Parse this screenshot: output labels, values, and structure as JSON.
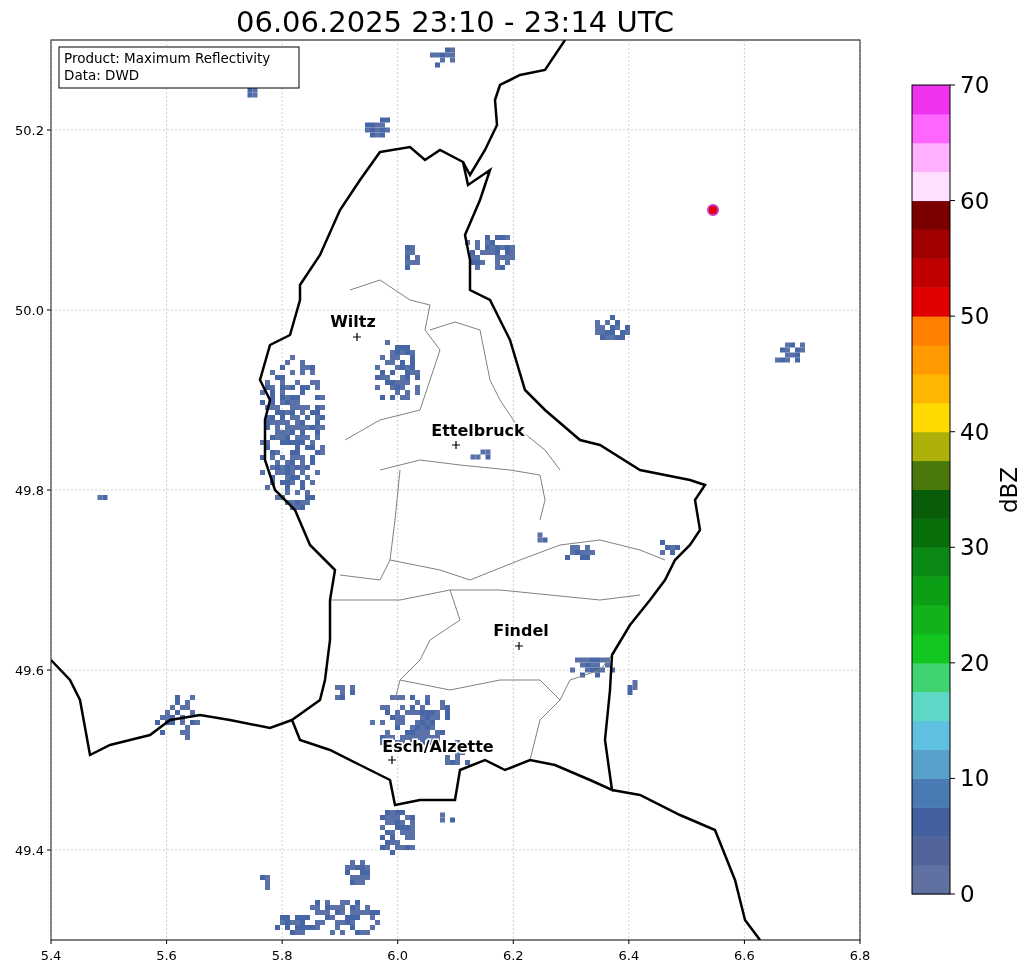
{
  "title": "06.06.2025 23:10 - 23:14 UTC",
  "info_box": {
    "lines": [
      "Product: Maximum Reflectivity",
      "Data: DWD"
    ]
  },
  "map": {
    "x_ticks": [
      "5.4",
      "5.6",
      "5.8",
      "6.0",
      "6.2",
      "6.4",
      "6.6",
      "6.8"
    ],
    "y_ticks": [
      "50.2",
      "50.0",
      "49.8",
      "49.6",
      "49.4"
    ],
    "cities": [
      {
        "name": "Wiltz"
      },
      {
        "name": "Ettelbruck"
      },
      {
        "name": "Findel"
      },
      {
        "name": "Esch/Alzette"
      }
    ]
  },
  "colorbar": {
    "label": "dBZ",
    "ticks": [
      "70",
      "60",
      "50",
      "40",
      "30",
      "20",
      "10",
      "0"
    ],
    "segments": [
      {
        "color": "#6070a0"
      },
      {
        "color": "#52649a"
      },
      {
        "color": "#4460a0"
      },
      {
        "color": "#4a7ab4"
      },
      {
        "color": "#58a0cc"
      },
      {
        "color": "#60c0e0"
      },
      {
        "color": "#60d8c8"
      },
      {
        "color": "#40d470"
      },
      {
        "color": "#12c820"
      },
      {
        "color": "#10b41a"
      },
      {
        "color": "#0c9e14"
      },
      {
        "color": "#0a8a14"
      },
      {
        "color": "#086e0a"
      },
      {
        "color": "#085c0a"
      },
      {
        "color": "#4a780a"
      },
      {
        "color": "#aeb00a"
      },
      {
        "color": "#ffd900"
      },
      {
        "color": "#ffb600"
      },
      {
        "color": "#ff9a00"
      },
      {
        "color": "#ff7f00"
      },
      {
        "color": "#e00000"
      },
      {
        "color": "#c00000"
      },
      {
        "color": "#a00000"
      },
      {
        "color": "#7a0000"
      },
      {
        "color": "#ffe0ff"
      },
      {
        "color": "#ffb0ff"
      },
      {
        "color": "#ff66ff"
      },
      {
        "color": "#ee33ee"
      }
    ]
  }
}
